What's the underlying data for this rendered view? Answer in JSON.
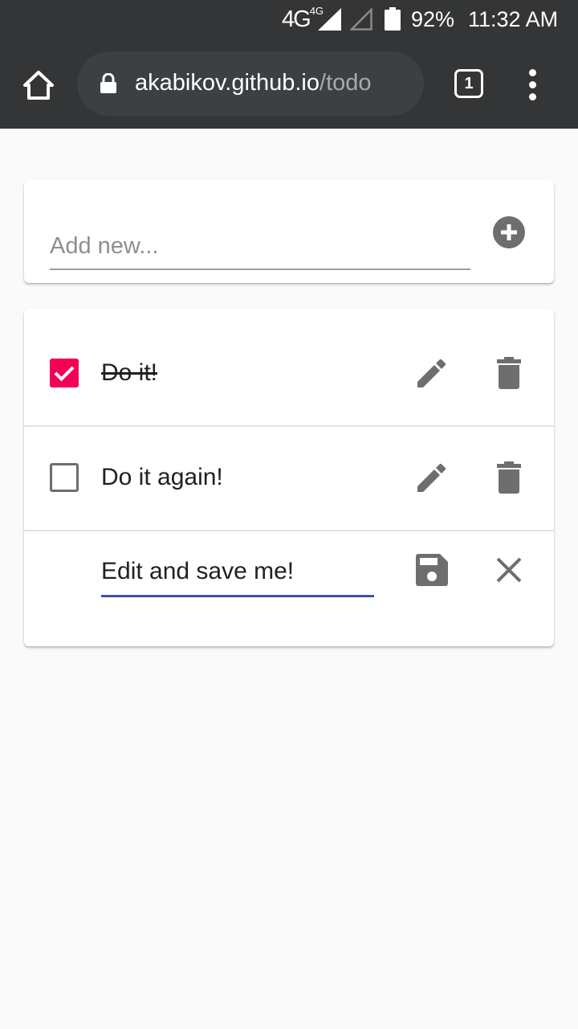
{
  "status_bar": {
    "network": "4G",
    "network_sub": "4G",
    "battery": "92%",
    "time": "11:32 AM"
  },
  "browser": {
    "url_host": "akabikov.github.io",
    "url_path": "/todo",
    "tab_count": "1"
  },
  "add_form": {
    "placeholder": "Add new..."
  },
  "todos": [
    {
      "text": "Do it!",
      "completed": true
    },
    {
      "text": "Do it again!",
      "completed": false
    }
  ],
  "editing": {
    "value": "Edit and save me!"
  },
  "colors": {
    "toolbar": "#333537",
    "checkbox_checked": "#f50057",
    "edit_underline": "#3f51b5",
    "icon": "#6e6e6e"
  }
}
